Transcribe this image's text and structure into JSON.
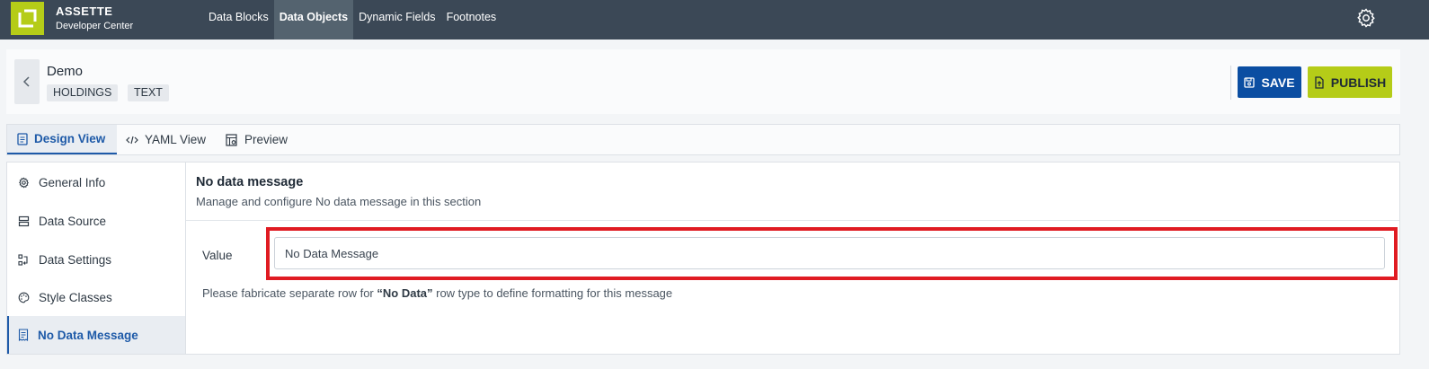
{
  "brand": {
    "title": "ASSETTE",
    "subtitle": "Developer Center",
    "color": "#b5cc18"
  },
  "nav": {
    "items": [
      {
        "label": "Data Blocks",
        "active": false
      },
      {
        "label": "Data Objects",
        "active": true
      },
      {
        "label": "Dynamic Fields",
        "active": false
      },
      {
        "label": "Footnotes",
        "active": false
      }
    ],
    "settings_icon": "gear-icon"
  },
  "header": {
    "title": "Demo",
    "tags": [
      "HOLDINGS",
      "TEXT"
    ],
    "save_label": "SAVE",
    "publish_label": "PUBLISH",
    "save_color": "#0b4ea2",
    "publish_color": "#b5cc18"
  },
  "tabs": [
    {
      "label": "Design View",
      "icon": "document-icon",
      "active": true
    },
    {
      "label": "YAML View",
      "icon": "code-icon",
      "active": false
    },
    {
      "label": "Preview",
      "icon": "preview-icon",
      "active": false
    }
  ],
  "sidebar": {
    "items": [
      {
        "label": "General Info",
        "icon": "gear-icon",
        "active": false
      },
      {
        "label": "Data Source",
        "icon": "database-icon",
        "active": false
      },
      {
        "label": "Data Settings",
        "icon": "settings-flow-icon",
        "active": false
      },
      {
        "label": "Style Classes",
        "icon": "palette-icon",
        "active": false
      },
      {
        "label": "No Data Message",
        "icon": "receipt-icon",
        "active": true
      }
    ]
  },
  "content": {
    "title": "No data message",
    "description": "Manage and configure No data message in this section",
    "value_label": "Value",
    "value": "No Data Message",
    "hint_before": "Please fabricate separate row for ",
    "hint_bold": "“No Data”",
    "hint_after": " row type to define formatting for this message",
    "highlight_color": "#e01b22"
  }
}
